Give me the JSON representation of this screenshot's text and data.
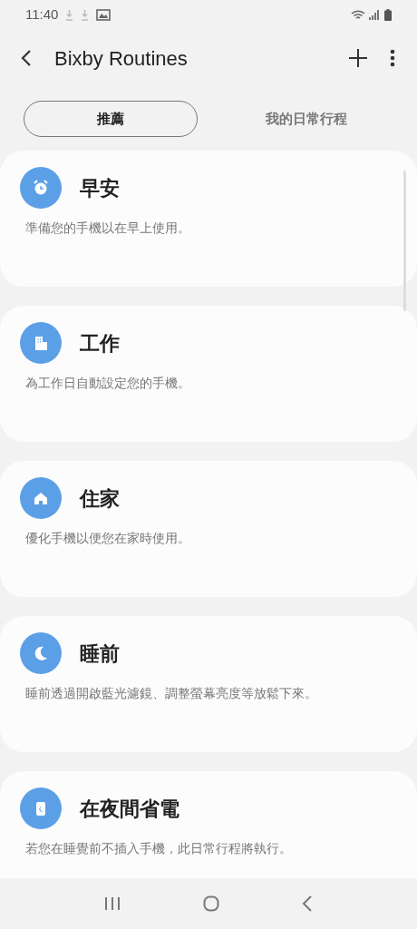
{
  "status_bar": {
    "time": "11:40"
  },
  "app_bar": {
    "title": "Bixby Routines"
  },
  "tabs": [
    {
      "label": "推薦",
      "selected": true
    },
    {
      "label": "我的日常行程",
      "selected": false
    }
  ],
  "routines": [
    {
      "kind": "alarm",
      "title": "早安",
      "description": "準備您的手機以在早上使用。"
    },
    {
      "kind": "building",
      "title": "工作",
      "description": "為工作日自動設定您的手機。"
    },
    {
      "kind": "house",
      "title": "住家",
      "description": "優化手機以便您在家時使用。"
    },
    {
      "kind": "moon",
      "title": "睡前",
      "description": "睡前透過開啟藍光濾鏡、調整螢幕亮度等放鬆下來。"
    },
    {
      "kind": "battery",
      "title": "在夜間省電",
      "description": "若您在睡覺前不插入手機，此日常行程將執行。"
    }
  ]
}
